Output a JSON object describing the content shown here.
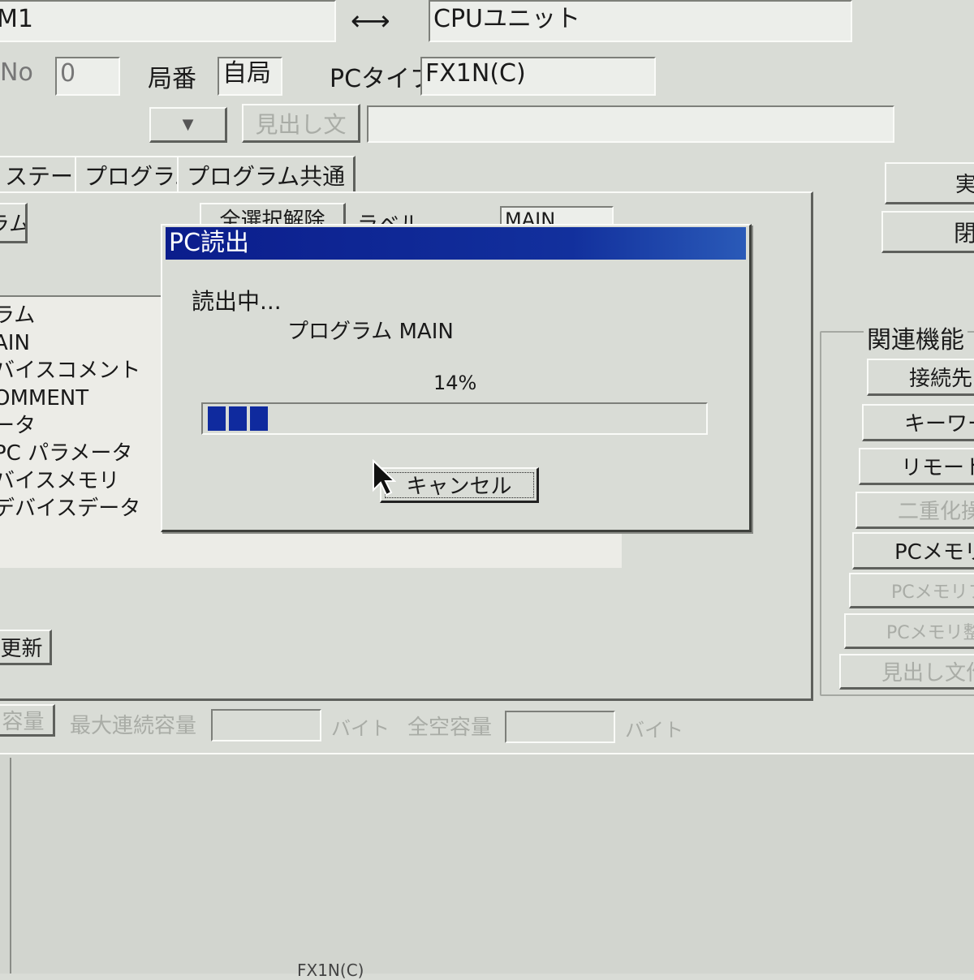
{
  "top": {
    "field_left": "M1",
    "arrow": "⟷",
    "target_unit": "CPUユニット",
    "no_label": "No",
    "no_value": "0",
    "station_label": "局番",
    "station_value": "自局",
    "pc_type_label": "PCタイプ",
    "pc_type_value": "FX1N(C)",
    "heading_button": "見出し文",
    "heading_value": ""
  },
  "tabs": [
    {
      "label": "ステータ"
    },
    {
      "label": "プログラム"
    },
    {
      "label": "プログラム共通"
    }
  ],
  "left_panel": {
    "top_button": "ラム",
    "partial_button": "全選択解除",
    "partial_label": "ラベル",
    "program_field": "MAIN",
    "list_items": [
      "ラム",
      "AIN",
      "バイスコメント",
      "OMMENT",
      "ータ",
      "PC パラメータ",
      "バイスメモリ",
      "デバイスデータ"
    ],
    "update_button": "更新"
  },
  "capacity": {
    "button": "容量",
    "max_label": "最大連続容量",
    "max_value": "",
    "unit1": "バイト",
    "total_label": "全空容量",
    "total_value": "",
    "unit2": "バイト"
  },
  "right": {
    "top_btn1": "実",
    "top_btn2": "閉",
    "group_title": "関連機能",
    "buttons": [
      {
        "label": "接続先",
        "enabled": true
      },
      {
        "label": "キーワード",
        "enabled": true
      },
      {
        "label": "リモート操",
        "enabled": true
      },
      {
        "label": "二重化操",
        "enabled": false
      },
      {
        "label": "PCメモリク",
        "enabled": true
      },
      {
        "label": "PCメモリフォー",
        "enabled": false
      },
      {
        "label": "PCメモリ整",
        "enabled": false
      },
      {
        "label": "見出し文作",
        "enabled": false
      }
    ]
  },
  "status_bar": {
    "text": "FX1N(C)"
  },
  "dialog": {
    "title": "PC読出",
    "status": "読出中...",
    "item": "プログラム  MAIN",
    "percent_text": "14%",
    "progress": 0.14,
    "cancel_button": "キャンセル"
  },
  "colors": {
    "titlebar": "#0b1d8c",
    "progress_block": "#0f2a9e",
    "window_bg": "#d9dcd6"
  }
}
